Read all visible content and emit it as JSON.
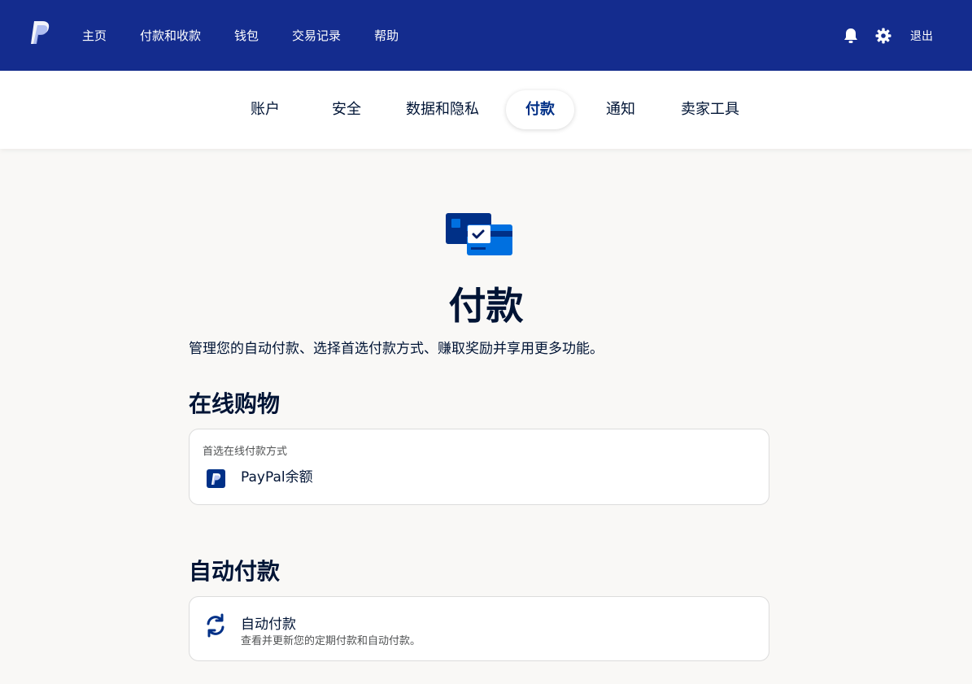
{
  "colors": {
    "topbar": "#142c8e",
    "accent": "#003087",
    "background": "#f9f8f6",
    "card_border": "#dcdcdc"
  },
  "header": {
    "logo_icon": "paypal-logo-icon",
    "nav": [
      "主页",
      "付款和收款",
      "钱包",
      "交易记录",
      "帮助"
    ],
    "notification_icon": "bell-icon",
    "settings_icon": "gear-icon",
    "logout_label": "退出"
  },
  "settings_tabs": {
    "items": [
      "账户",
      "安全",
      "数据和隐私",
      "付款",
      "通知",
      "卖家工具"
    ],
    "active": "付款"
  },
  "main": {
    "hero_icon": "payment-cards-icon",
    "title": "付款",
    "description": "管理您的自动付款、选择首选付款方式、赚取奖励并享用更多功能。",
    "online_shopping": {
      "heading": "在线购物",
      "card_label": "首选在线付款方式",
      "card_icon": "paypal-badge-icon",
      "card_value": "PayPal余额"
    },
    "auto_payments": {
      "heading": "自动付款",
      "card_icon": "refresh-icon",
      "card_title": "自动付款",
      "card_subtitle": "查看并更新您的定期付款和自动付款。"
    }
  }
}
